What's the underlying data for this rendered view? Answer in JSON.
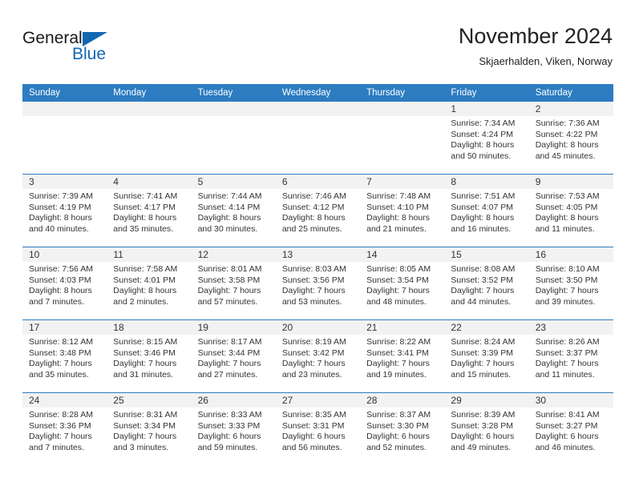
{
  "brand": {
    "name_part1": "General",
    "name_part2": "Blue",
    "accent_color": "#1267b2"
  },
  "header": {
    "title": "November 2024",
    "location": "Skjaerhalden, Viken, Norway"
  },
  "calendar": {
    "header_color": "#2d7cc1",
    "weekdays": [
      "Sunday",
      "Monday",
      "Tuesday",
      "Wednesday",
      "Thursday",
      "Friday",
      "Saturday"
    ],
    "weeks": [
      [
        {
          "day": "",
          "empty": true
        },
        {
          "day": "",
          "empty": true
        },
        {
          "day": "",
          "empty": true
        },
        {
          "day": "",
          "empty": true
        },
        {
          "day": "",
          "empty": true
        },
        {
          "day": "1",
          "sunrise": "Sunrise: 7:34 AM",
          "sunset": "Sunset: 4:24 PM",
          "daylight_1": "Daylight: 8 hours",
          "daylight_2": "and 50 minutes."
        },
        {
          "day": "2",
          "sunrise": "Sunrise: 7:36 AM",
          "sunset": "Sunset: 4:22 PM",
          "daylight_1": "Daylight: 8 hours",
          "daylight_2": "and 45 minutes."
        }
      ],
      [
        {
          "day": "3",
          "sunrise": "Sunrise: 7:39 AM",
          "sunset": "Sunset: 4:19 PM",
          "daylight_1": "Daylight: 8 hours",
          "daylight_2": "and 40 minutes."
        },
        {
          "day": "4",
          "sunrise": "Sunrise: 7:41 AM",
          "sunset": "Sunset: 4:17 PM",
          "daylight_1": "Daylight: 8 hours",
          "daylight_2": "and 35 minutes."
        },
        {
          "day": "5",
          "sunrise": "Sunrise: 7:44 AM",
          "sunset": "Sunset: 4:14 PM",
          "daylight_1": "Daylight: 8 hours",
          "daylight_2": "and 30 minutes."
        },
        {
          "day": "6",
          "sunrise": "Sunrise: 7:46 AM",
          "sunset": "Sunset: 4:12 PM",
          "daylight_1": "Daylight: 8 hours",
          "daylight_2": "and 25 minutes."
        },
        {
          "day": "7",
          "sunrise": "Sunrise: 7:48 AM",
          "sunset": "Sunset: 4:10 PM",
          "daylight_1": "Daylight: 8 hours",
          "daylight_2": "and 21 minutes."
        },
        {
          "day": "8",
          "sunrise": "Sunrise: 7:51 AM",
          "sunset": "Sunset: 4:07 PM",
          "daylight_1": "Daylight: 8 hours",
          "daylight_2": "and 16 minutes."
        },
        {
          "day": "9",
          "sunrise": "Sunrise: 7:53 AM",
          "sunset": "Sunset: 4:05 PM",
          "daylight_1": "Daylight: 8 hours",
          "daylight_2": "and 11 minutes."
        }
      ],
      [
        {
          "day": "10",
          "sunrise": "Sunrise: 7:56 AM",
          "sunset": "Sunset: 4:03 PM",
          "daylight_1": "Daylight: 8 hours",
          "daylight_2": "and 7 minutes."
        },
        {
          "day": "11",
          "sunrise": "Sunrise: 7:58 AM",
          "sunset": "Sunset: 4:01 PM",
          "daylight_1": "Daylight: 8 hours",
          "daylight_2": "and 2 minutes."
        },
        {
          "day": "12",
          "sunrise": "Sunrise: 8:01 AM",
          "sunset": "Sunset: 3:58 PM",
          "daylight_1": "Daylight: 7 hours",
          "daylight_2": "and 57 minutes."
        },
        {
          "day": "13",
          "sunrise": "Sunrise: 8:03 AM",
          "sunset": "Sunset: 3:56 PM",
          "daylight_1": "Daylight: 7 hours",
          "daylight_2": "and 53 minutes."
        },
        {
          "day": "14",
          "sunrise": "Sunrise: 8:05 AM",
          "sunset": "Sunset: 3:54 PM",
          "daylight_1": "Daylight: 7 hours",
          "daylight_2": "and 48 minutes."
        },
        {
          "day": "15",
          "sunrise": "Sunrise: 8:08 AM",
          "sunset": "Sunset: 3:52 PM",
          "daylight_1": "Daylight: 7 hours",
          "daylight_2": "and 44 minutes."
        },
        {
          "day": "16",
          "sunrise": "Sunrise: 8:10 AM",
          "sunset": "Sunset: 3:50 PM",
          "daylight_1": "Daylight: 7 hours",
          "daylight_2": "and 39 minutes."
        }
      ],
      [
        {
          "day": "17",
          "sunrise": "Sunrise: 8:12 AM",
          "sunset": "Sunset: 3:48 PM",
          "daylight_1": "Daylight: 7 hours",
          "daylight_2": "and 35 minutes."
        },
        {
          "day": "18",
          "sunrise": "Sunrise: 8:15 AM",
          "sunset": "Sunset: 3:46 PM",
          "daylight_1": "Daylight: 7 hours",
          "daylight_2": "and 31 minutes."
        },
        {
          "day": "19",
          "sunrise": "Sunrise: 8:17 AM",
          "sunset": "Sunset: 3:44 PM",
          "daylight_1": "Daylight: 7 hours",
          "daylight_2": "and 27 minutes."
        },
        {
          "day": "20",
          "sunrise": "Sunrise: 8:19 AM",
          "sunset": "Sunset: 3:42 PM",
          "daylight_1": "Daylight: 7 hours",
          "daylight_2": "and 23 minutes."
        },
        {
          "day": "21",
          "sunrise": "Sunrise: 8:22 AM",
          "sunset": "Sunset: 3:41 PM",
          "daylight_1": "Daylight: 7 hours",
          "daylight_2": "and 19 minutes."
        },
        {
          "day": "22",
          "sunrise": "Sunrise: 8:24 AM",
          "sunset": "Sunset: 3:39 PM",
          "daylight_1": "Daylight: 7 hours",
          "daylight_2": "and 15 minutes."
        },
        {
          "day": "23",
          "sunrise": "Sunrise: 8:26 AM",
          "sunset": "Sunset: 3:37 PM",
          "daylight_1": "Daylight: 7 hours",
          "daylight_2": "and 11 minutes."
        }
      ],
      [
        {
          "day": "24",
          "sunrise": "Sunrise: 8:28 AM",
          "sunset": "Sunset: 3:36 PM",
          "daylight_1": "Daylight: 7 hours",
          "daylight_2": "and 7 minutes."
        },
        {
          "day": "25",
          "sunrise": "Sunrise: 8:31 AM",
          "sunset": "Sunset: 3:34 PM",
          "daylight_1": "Daylight: 7 hours",
          "daylight_2": "and 3 minutes."
        },
        {
          "day": "26",
          "sunrise": "Sunrise: 8:33 AM",
          "sunset": "Sunset: 3:33 PM",
          "daylight_1": "Daylight: 6 hours",
          "daylight_2": "and 59 minutes."
        },
        {
          "day": "27",
          "sunrise": "Sunrise: 8:35 AM",
          "sunset": "Sunset: 3:31 PM",
          "daylight_1": "Daylight: 6 hours",
          "daylight_2": "and 56 minutes."
        },
        {
          "day": "28",
          "sunrise": "Sunrise: 8:37 AM",
          "sunset": "Sunset: 3:30 PM",
          "daylight_1": "Daylight: 6 hours",
          "daylight_2": "and 52 minutes."
        },
        {
          "day": "29",
          "sunrise": "Sunrise: 8:39 AM",
          "sunset": "Sunset: 3:28 PM",
          "daylight_1": "Daylight: 6 hours",
          "daylight_2": "and 49 minutes."
        },
        {
          "day": "30",
          "sunrise": "Sunrise: 8:41 AM",
          "sunset": "Sunset: 3:27 PM",
          "daylight_1": "Daylight: 6 hours",
          "daylight_2": "and 46 minutes."
        }
      ]
    ]
  }
}
